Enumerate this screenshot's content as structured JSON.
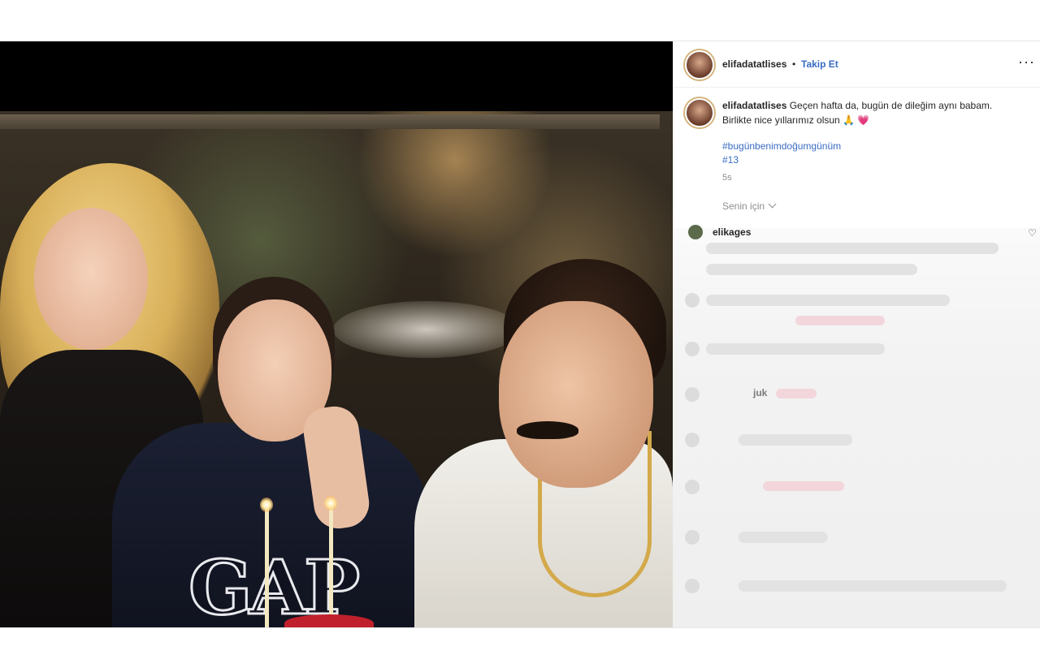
{
  "post": {
    "username": "elifadatatlises",
    "dot": "•",
    "follow_label": "Takip Et",
    "more_label": "···",
    "caption_user": "elifadatatlises",
    "caption_text": "Geçen hafta da, bugün de dileğim aynı babam. Birlikte nice yıllarımız olsun",
    "caption_emojis": "🙏 ",
    "caption_heart": "💗",
    "hashtag": "#bugünbenimdoğumgünüm",
    "hashtag2": "#13",
    "time": "5s",
    "for_you_label": "Senin için"
  },
  "comments": {
    "first_user_partial": "elikages",
    "partial_word": "juk",
    "like_glyph": "♡"
  },
  "photo": {
    "logo_text": "GAP"
  },
  "icons": {
    "more": "more-options-icon",
    "like": "heart-icon",
    "chevron": "chevron-down-icon"
  },
  "colors": {
    "link": "#3b6cc4",
    "secondary_text": "#8e8e8e",
    "primary_text": "#262626"
  }
}
